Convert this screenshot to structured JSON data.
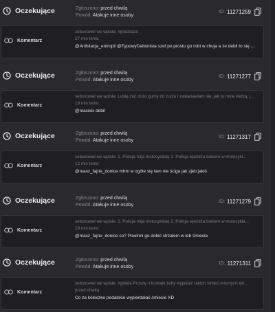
{
  "reports": [
    {
      "status": "Oczekujące",
      "reported_label": "Zgłoszono:",
      "reported_value": "przed chwilą",
      "reason_label": "Powód:",
      "reason_value": "Atakuje inne osoby",
      "id_label": "ID:",
      "id_value": "11271259",
      "content_type": "Komentarz",
      "context": "seboxowel we wpisie: #pracbaza",
      "time": "27 min temu",
      "text": "@Anihilacja_entropii @TypowyDaltonista szef po prostu go robi w chuja a że debil to się ..."
    },
    {
      "status": "Oczekujące",
      "reported_label": "Zgłoszono:",
      "reported_value": "przed chwilą",
      "reason_label": "Powód:",
      "reason_value": "Atakuje inne osoby",
      "id_label": "ID:",
      "id_value": "11271277",
      "content_type": "Komentarz",
      "context": "seboxowel we wpisie: Lubię żuć dużo gumy do żucia i zastanawiam się, jak to mnie widzą, j...",
      "time": "19 min temu",
      "text": "@maxixix debil"
    },
    {
      "status": "Oczekujące",
      "reported_label": "Zgłoszono:",
      "reported_value": "przed chwilą",
      "reason_label": "Powód:",
      "reason_value": "Atakuje inne osoby",
      "id_label": "ID:",
      "id_value": "11271317",
      "content_type": "Komentarz",
      "context": "seboxowel we wpisie: 1. Policja mija motocyklistę 2. Policja wjeżdża bokiem w motocykl...",
      "time": "12 min temu",
      "text": "@masz_fajne_donice mhm w ogóle się tam nie ściga jak zjeb jakiś"
    },
    {
      "status": "Oczekujące",
      "reported_label": "Zgłoszono:",
      "reported_value": "przed chwilą",
      "reason_label": "Powód:",
      "reason_value": "Atakuje inne osoby",
      "id_label": "ID:",
      "id_value": "11271279",
      "content_type": "Komentarz",
      "context": "seboxowel we wpisie: 1. Policja mija motocyklistę 2. Policja wjeżdża bokiem w motocykla...",
      "time": "19 min temu",
      "text": "@masz_fajne_donice co? Powinni go dobić strzałem w łeb śmiecia"
    },
    {
      "status": "Oczekujące",
      "reported_label": "Zgłoszono:",
      "reported_value": "przed chwilą",
      "reason_label": "Powód:",
      "reason_value": "Atakuje inne osoby",
      "id_label": "ID:",
      "id_value": "11271311",
      "content_type": "Komentarz",
      "context": "seboxowel we wpisie: #gielda Proszę o kontakt żeby wyjaśnić takich śmieci mocnych tyk...",
      "time": "przed chwilą",
      "text": "Co za kółeczko pedalskie wypierdalać śmiecie XD"
    }
  ],
  "icons": {
    "status": "clock-icon",
    "content_type": "link-icon",
    "copy": "copy-icon"
  },
  "colors": {
    "background": "#2a2a2c",
    "card": "#1f1f21",
    "muted_text": "#8a8a8d",
    "primary_text": "#e4e4e4"
  }
}
